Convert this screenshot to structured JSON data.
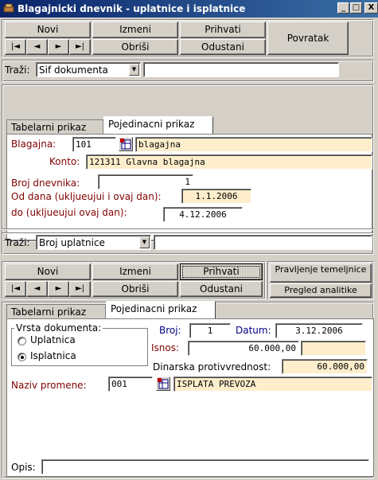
{
  "window": {
    "title": "Blagajnicki dnevnik - uplatnice i isplatnice",
    "controls": {
      "minimize": "_",
      "maximize": "□",
      "close": "X"
    }
  },
  "top_toolbar": {
    "novi": "Novi",
    "izmeni": "Izmeni",
    "prihvati": "Prihvati",
    "obrisi": "Obriši",
    "odustani": "Odustani",
    "povratak": "Povratak",
    "nav": {
      "first": "|◄",
      "prev": "◄",
      "next": "►",
      "last": "►|"
    }
  },
  "search1": {
    "label": "Traži:",
    "field": "Sif dokumenta",
    "value": ""
  },
  "tabs1": {
    "tabelarni": "Tabelarni prikaz",
    "pojedinacni": "Pojedinacni prikaz"
  },
  "header": {
    "blagajna_label": "Blagajna:",
    "blagajna_code": "101",
    "blagajna_name": "blagajna",
    "konto_label": "Konto:",
    "konto_value": "121311 Glavna blagajna",
    "broj_dnevnika_label": "Broj dnevnika:",
    "broj_dnevnika_value": "1",
    "od_dana_label": "Od dana (ukljueujui i ovaj dan):",
    "od_dana_value": "1.1.2006",
    "do_label": "do (ukljueujui ovaj dan):",
    "do_value": "4.12.2006"
  },
  "search2": {
    "label": "Traži:",
    "field": "Broj uplatnice",
    "value": ""
  },
  "bottom_toolbar": {
    "novi": "Novi",
    "izmeni": "Izmeni",
    "prihvati": "Prihvati",
    "obrisi": "Obriši",
    "odustani": "Odustani",
    "pravljenje": "Pravljenje temeljnice",
    "pregled": "Pregled analitike",
    "nav": {
      "first": "|◄",
      "prev": "◄",
      "next": "►",
      "last": "►|"
    }
  },
  "tabs2": {
    "tabelarni": "Tabelarni prikaz",
    "pojedinacni": "Pojedinacni prikaz"
  },
  "detail": {
    "vrsta_label": "Vrsta dokumenta:",
    "uplatnica": "Uplatnica",
    "isplatnica": "Isplatnica",
    "selected": "Isplatnica",
    "broj_label": "Broj:",
    "broj_value": "1",
    "datum_label": "Datum:",
    "datum_value": "3.12.2006",
    "iznos_label": "Isnos:",
    "iznos_value": "60.000,00",
    "iznos_extra": "",
    "dinarska_label": "Dinarska protivvrednost:",
    "dinarska_value": "60.000,00",
    "naziv_label": "Naziv promene:",
    "naziv_code": "001",
    "naziv_name": "ISPLATA PREVOZA",
    "opis_label": "Opis:",
    "opis_value": ""
  },
  "colors": {
    "title_start": "#0a246a",
    "title_end": "#3a6ea5",
    "readonly": "#ffeecc",
    "label_maroon": "#800000",
    "label_blue": "#000080"
  }
}
